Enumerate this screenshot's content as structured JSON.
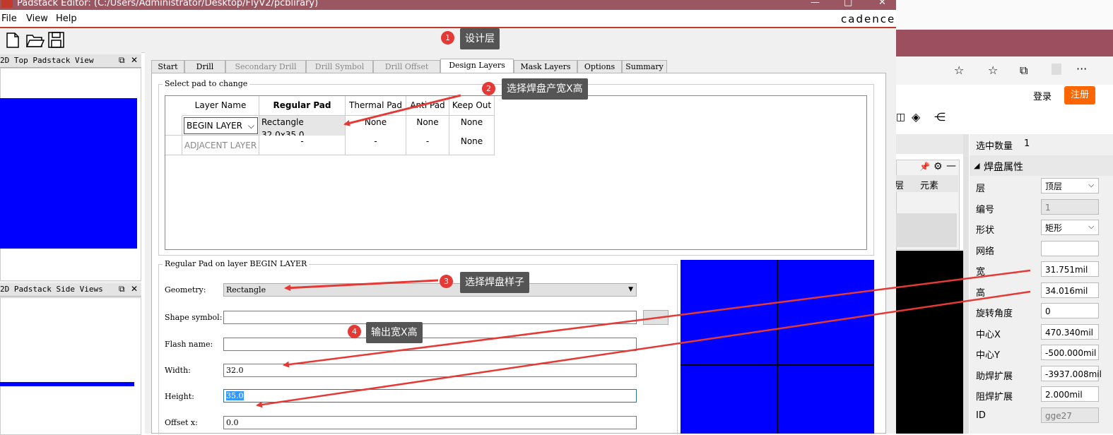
{
  "window": {
    "title": "Padstack Editor:   (C:/Users/Administrator/Desktop/FlyV2/pcblirary)",
    "brand": "cadence",
    "controls": [
      "—",
      "□",
      "✕"
    ]
  },
  "menu": [
    "File",
    "View",
    "Help"
  ],
  "toolbar": {
    "icons": [
      "new-file-icon",
      "open-folder-icon",
      "save-icon"
    ]
  },
  "left_panels": {
    "top_view_title": "2D Top Padstack View",
    "side_view_title": "2D Padstack Side Views",
    "panel_buttons": [
      "⧉",
      "✕"
    ]
  },
  "tabs": [
    {
      "label": "Start",
      "state": "normal"
    },
    {
      "label": "Drill",
      "state": "normal"
    },
    {
      "label": "Secondary Drill",
      "state": "disabled"
    },
    {
      "label": "Drill Symbol",
      "state": "disabled"
    },
    {
      "label": "Drill Offset",
      "state": "disabled"
    },
    {
      "label": "Design Layers",
      "state": "active"
    },
    {
      "label": "Mask Layers",
      "state": "normal"
    },
    {
      "label": "Options",
      "state": "normal"
    },
    {
      "label": "Summary",
      "state": "normal"
    }
  ],
  "select_pad": {
    "group_title": "Select pad to change",
    "columns": [
      "Layer Name",
      "Regular Pad",
      "Thermal Pad",
      "Anti Pad",
      "Keep Out"
    ],
    "rows": [
      {
        "layer": "BEGIN LAYER",
        "regular": "Rectangle 32.0x35.0",
        "thermal": "None",
        "anti": "None",
        "keepout": "None"
      },
      {
        "layer": "ADJACENT LAYER",
        "regular": "-",
        "thermal": "-",
        "anti": "-",
        "keepout": "None"
      }
    ]
  },
  "regular_pad": {
    "group_title": "Regular Pad on layer BEGIN LAYER",
    "geometry_label": "Geometry:",
    "geometry_value": "Rectangle",
    "shape_symbol_label": "Shape symbol:",
    "shape_symbol_value": "",
    "flash_name_label": "Flash name:",
    "flash_name_value": "",
    "width_label": "Width:",
    "width_value": "32.0",
    "height_label": "Height:",
    "height_value": "35.0",
    "offset_x_label": "Offset x:",
    "offset_x_value": "0.0"
  },
  "annotations": [
    {
      "num": "1",
      "text": "设计层"
    },
    {
      "num": "2",
      "text": "选择焊盘产宽X高"
    },
    {
      "num": "3",
      "text": "选择焊盘样子"
    },
    {
      "num": "4",
      "text": "输出宽X高"
    }
  ],
  "bg_app": {
    "login": "登录",
    "register": "注册",
    "panel_tabs": [
      "层",
      "元素"
    ],
    "selected_count_label": "选中数量",
    "selected_count": "1",
    "pad_props_title": "焊盘属性",
    "props": [
      {
        "label": "层",
        "value": "顶层",
        "type": "select"
      },
      {
        "label": "编号",
        "value": "1",
        "type": "readonly"
      },
      {
        "label": "形状",
        "value": "矩形",
        "type": "select"
      },
      {
        "label": "网络",
        "value": "",
        "type": "input"
      },
      {
        "label": "宽",
        "value": "31.751mil",
        "type": "input"
      },
      {
        "label": "高",
        "value": "34.016mil",
        "type": "input"
      },
      {
        "label": "旋转角度",
        "value": "0",
        "type": "input"
      },
      {
        "label": "中心X",
        "value": "470.340mil",
        "type": "input"
      },
      {
        "label": "中心Y",
        "value": "-500.000mil",
        "type": "input"
      },
      {
        "label": "助焊扩展",
        "value": "-3937.008mil",
        "type": "input"
      },
      {
        "label": "阻焊扩展",
        "value": "2.000mil",
        "type": "input"
      },
      {
        "label": "ID",
        "value": "gge27",
        "type": "readonly"
      }
    ]
  },
  "colors": {
    "titlebar": "#9a5762",
    "pad_blue": "#0000ff",
    "annotation_red": "#e53935",
    "register_orange": "#ff6600"
  }
}
